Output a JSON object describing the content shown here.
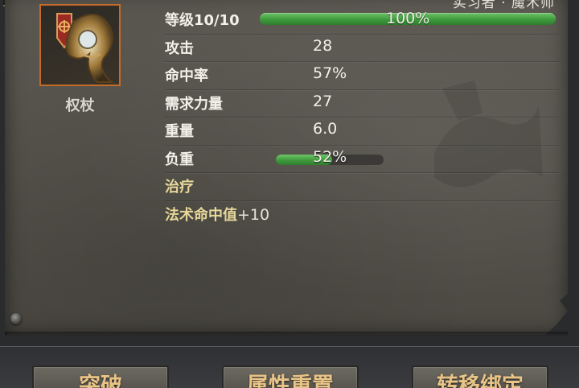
{
  "header": {
    "top_right_text": "实习者 · 魔术师"
  },
  "item": {
    "name": "权杖",
    "icon": "scepter-icon"
  },
  "stats": {
    "level_label": "等级10/10",
    "level_percent_text": "100%",
    "level_progress": 1.0,
    "attack_label": "攻击",
    "attack_value": "28",
    "hit_label": "命中率",
    "hit_value": "57%",
    "str_req_label": "需求力量",
    "str_req_value": "27",
    "weight_label": "重量",
    "weight_value": "6.0",
    "load_label": "负重",
    "load_percent_text": "52%",
    "load_progress": 0.52,
    "heal_label": "治疗",
    "spell_hit_label": "法术命中值",
    "spell_hit_value": "+10"
  },
  "buttons": {
    "left_label": "突破",
    "middle_label": "属性重置",
    "right_label": "转移绑定"
  },
  "colors": {
    "accent_gold": "#e9c487",
    "bar_green": "#3f9a3c",
    "icon_border": "#c46a2a"
  }
}
